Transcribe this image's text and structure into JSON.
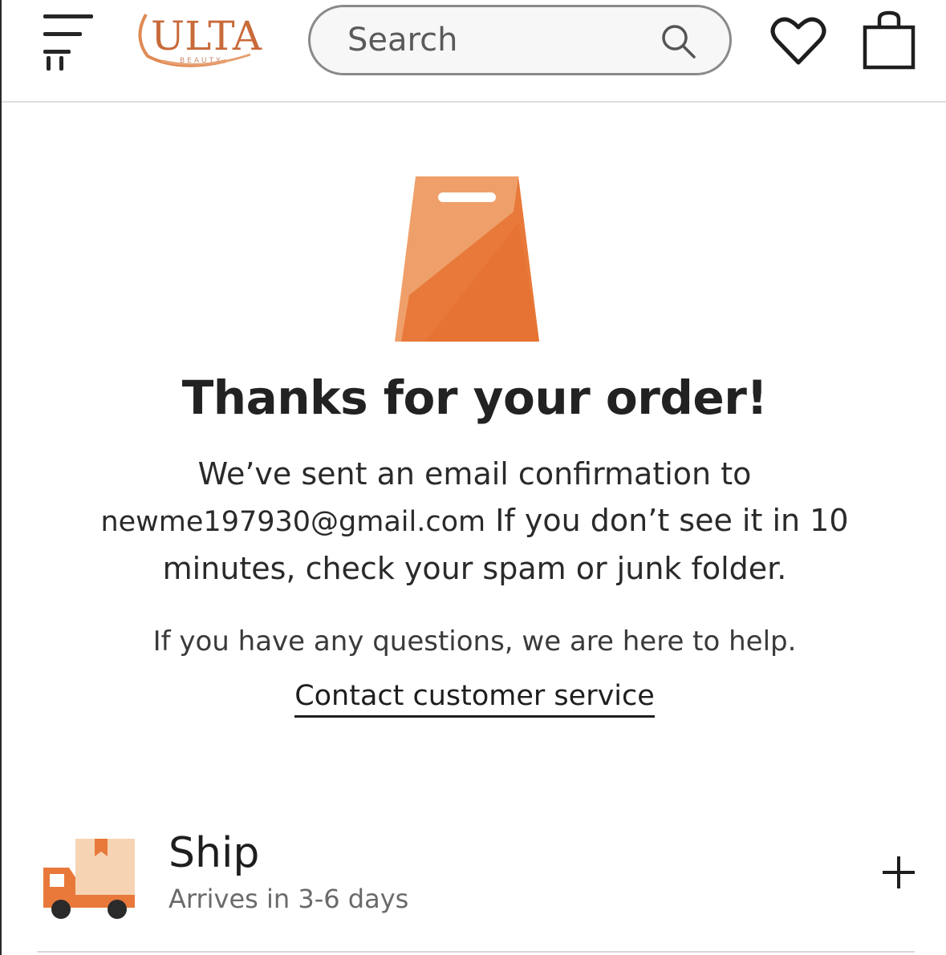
{
  "header": {
    "logo_text": "ULTA",
    "logo_subtext": "BEAUTY",
    "search_placeholder": "Search",
    "menu_icon": "hamburger-icon",
    "search_icon": "search-icon",
    "wishlist_icon": "heart-icon",
    "bag_icon": "shopping-bag-icon"
  },
  "confirmation": {
    "hero_icon": "shopping-bag-icon",
    "title": "Thanks for your order!",
    "line1": "We’ve sent an email confirmation to",
    "email": "newme197930@gmail.com",
    "line2": "If you don’t see it in 10",
    "line3": "minutes, check your spam or junk folder.",
    "help_text": "If you have any questions, we are here to help.",
    "contact_link": "Contact customer service"
  },
  "shipping": {
    "icon": "truck-icon",
    "title": "Ship",
    "subtitle": "Arrives in 3-6 days",
    "expand_label": "+"
  },
  "colors": {
    "brand_orange": "#E8793A",
    "brand_orange_light": "#F0A070",
    "text_dark": "#222222",
    "text_muted": "#6A6A6A"
  }
}
